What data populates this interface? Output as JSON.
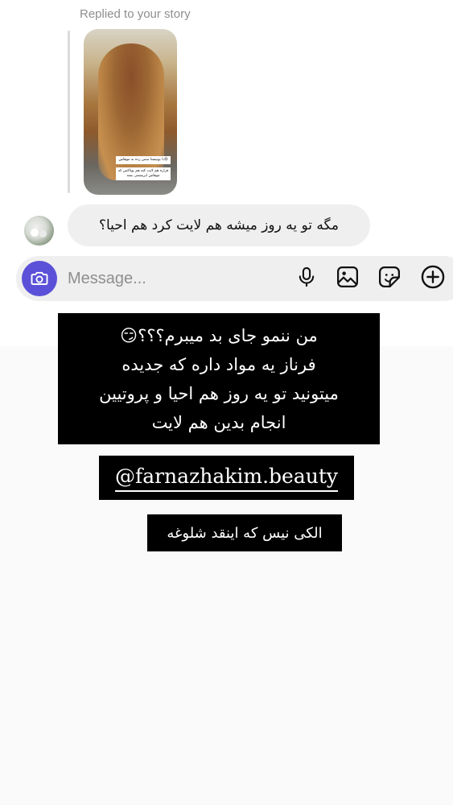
{
  "reply_header": {
    "label": "Replied to your story"
  },
  "story_thumbnail": {
    "caption_line1": "با بوتیستا سس زده به موهاش😄",
    "caption_line2": "قراره هم لایت کنه هم بوتاکس که موهاش ابریشمی بشه"
  },
  "message": {
    "text": "مگه تو یه روز میشه هم لایت کرد هم احیا؟"
  },
  "composer": {
    "placeholder": "Message...",
    "accent_color": "#5b51d8",
    "icons": [
      "camera-icon",
      "microphone-icon",
      "gallery-icon",
      "sticker-icon",
      "add-icon"
    ]
  },
  "story_overlay": {
    "lines": [
      "من ننمو جای بد میبرم؟؟؟😏",
      "فرناز یه مواد داره که جدیده",
      "میتونید تو یه روز هم احیا و پروتیین",
      "انجام بدین هم لایت"
    ],
    "mention": "@farnazhakim.beauty",
    "footer": "الکی نیس که اینقد شلوغه"
  }
}
